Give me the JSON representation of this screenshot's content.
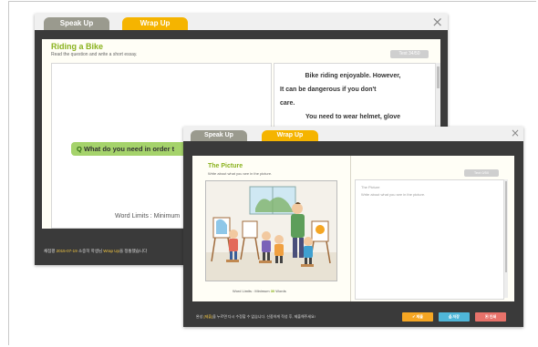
{
  "back_window": {
    "tabs": [
      {
        "label": "Speak Up",
        "active": false
      },
      {
        "label": "Wrap Up",
        "active": true
      }
    ],
    "close_glyph": "×",
    "title": "Riding a Bike",
    "instruction": "Read the question and write a short essay.",
    "text_counter": "Text 34/50",
    "essay_lines": [
      "Bike riding enjoyable. However,",
      "It can be dangerous if you don't",
      "care.",
      "You need to wear helmet, glove"
    ],
    "question": "What do you need in order t",
    "question_mark": "Q",
    "word_limit": "Word Limits : Minimum",
    "footer": {
      "prefix": "채점평 ",
      "date": "2015-07-19",
      "middle": " 소중히 학생님 ",
      "brand": "Wrap Up",
      "suffix": "을 정통했습니다"
    }
  },
  "front_window": {
    "tabs": [
      {
        "label": "Speak Up",
        "active": false
      },
      {
        "label": "Wrap Up",
        "active": true
      }
    ],
    "close_glyph": "×",
    "title": "The Picture",
    "instruction": "Write about what you see in the picture.",
    "text_counter": "Text 0/50",
    "answer_text": [
      "The Picture",
      "Write about what you see in the picture."
    ],
    "word_limit": "Word Limits : Minimum 30 Words",
    "word_limit_parts": {
      "before": "Word Limits : Minimum ",
      "num": "30",
      "after": " Words"
    },
    "footer": {
      "prefix": "완성 ",
      "hl": "[제출]",
      "suffix": "을 누르면 다시 수정할 수 없습니다. 신중하게 작성 후, 제출해주세요!"
    },
    "buttons": [
      {
        "label": "제출",
        "icon": "check-icon",
        "color": "#f5a623"
      },
      {
        "label": "저장",
        "icon": "save-icon",
        "color": "#4fb6d9"
      },
      {
        "label": "인쇄",
        "icon": "print-icon",
        "color": "#e8726a"
      }
    ]
  }
}
